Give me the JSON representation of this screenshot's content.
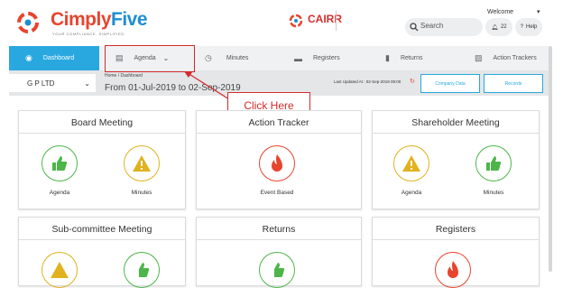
{
  "header": {
    "brand_part1": "Cimply",
    "brand_part2": "Five",
    "brand_tagline": "YOUR COMPLIANCE. SIMPLIFIED.",
    "product": "CAIRR",
    "search_placeholder": "Search",
    "welcome": "Welcome",
    "notif_count": "22",
    "help_label": "Help"
  },
  "nav": {
    "dashboard": "Dashboard",
    "agenda": "Agenda",
    "minutes": "Minutes",
    "registers": "Registers",
    "returns": "Returns",
    "action_trackers": "Action Trackers"
  },
  "subbar": {
    "company": "G P LTD",
    "breadcrumb": "Home / Dashboard",
    "date_range": "From 01-Jul-2019 to 02-Sep-2019",
    "last_updated": "Last Updated At : 02-Sep-2019 09:00",
    "company_data_button": "Company Data",
    "records_button": "Records"
  },
  "callout": {
    "text": "Click Here"
  },
  "cards": [
    {
      "title": "Board Meeting",
      "items": [
        {
          "label": "Agenda",
          "icon": "thumbs-up-icon"
        },
        {
          "label": "Minutes",
          "icon": "warning-icon"
        }
      ]
    },
    {
      "title": "Action Tracker",
      "items": [
        {
          "label": "Event Based",
          "icon": "flame-icon"
        }
      ]
    },
    {
      "title": "Shareholder Meeting",
      "items": [
        {
          "label": "Agenda",
          "icon": "warning-icon"
        },
        {
          "label": "Minutes",
          "icon": "thumbs-up-icon"
        }
      ]
    },
    {
      "title": "Sub-committee Meeting",
      "items": []
    },
    {
      "title": "Returns",
      "items": []
    },
    {
      "title": "Registers",
      "items": []
    }
  ],
  "colors": {
    "brand_red": "#e8442e",
    "brand_blue": "#1f8ed1",
    "accent": "#29a8e0",
    "green": "#4cb649",
    "yellow": "#e0b21d",
    "callout_red": "#d42a2a"
  }
}
